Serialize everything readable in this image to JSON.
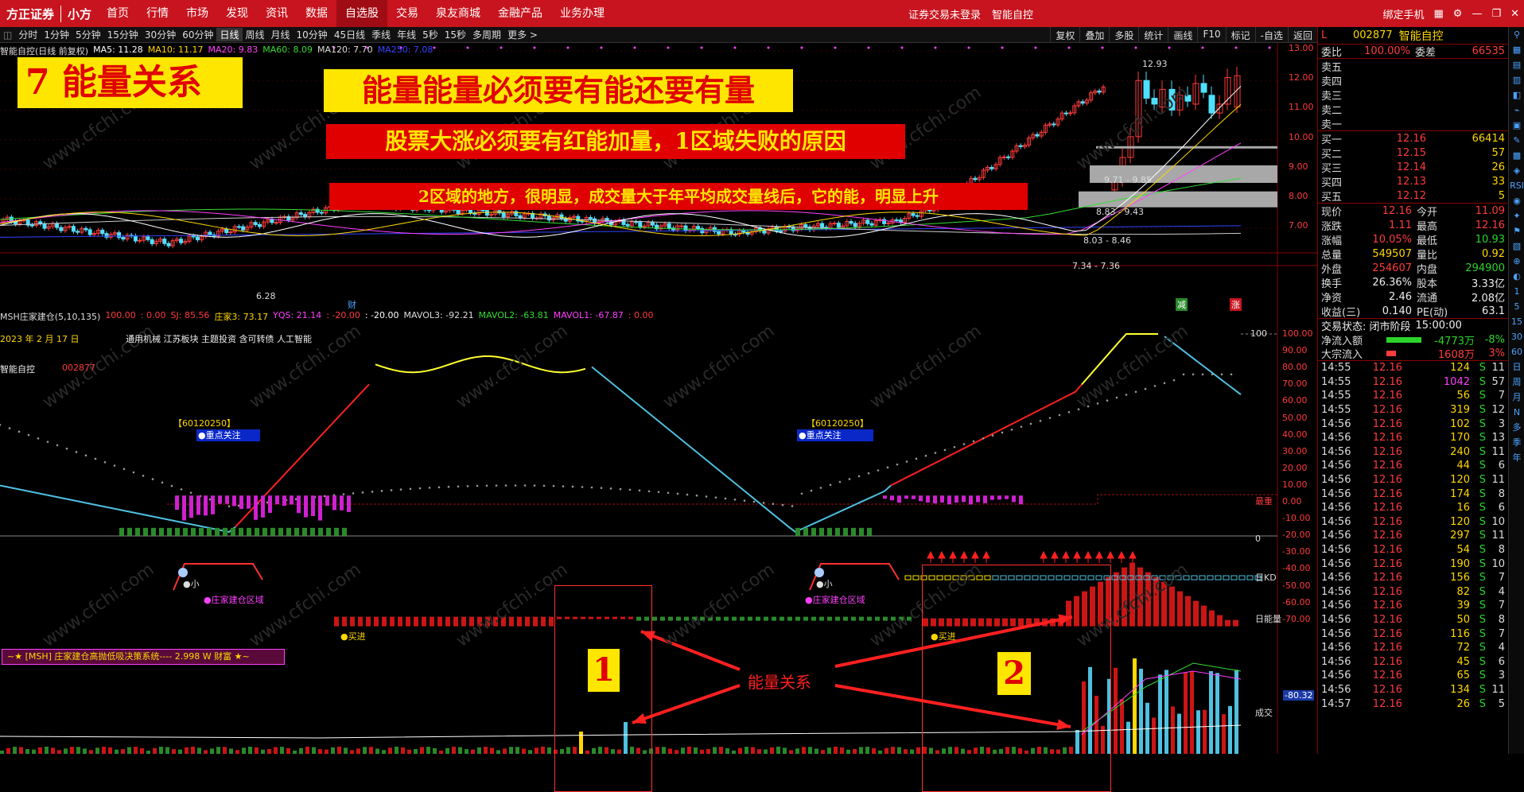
{
  "topbar": {
    "logo": "方正证券",
    "logo_sub": "小方",
    "nav": [
      "首页",
      "行情",
      "市场",
      "发现",
      "资讯",
      "数据",
      "自选股",
      "交易",
      "泉友商城",
      "金融产品",
      "业务办理"
    ],
    "nav_active": "自选股",
    "login_status": "证券交易未登录",
    "stock_name": "智能自控",
    "bind_phone": "绑定手机"
  },
  "periodbar": {
    "periods": [
      "分时",
      "1分钟",
      "5分钟",
      "15分钟",
      "30分钟",
      "60分钟",
      "日线",
      "周线",
      "月线",
      "10分钟",
      "45日线",
      "季线",
      "年线",
      "5秒",
      "15秒",
      "多周期",
      "更多 >"
    ],
    "active": "日线",
    "tools": [
      "复权",
      "叠加",
      "多股",
      "统计",
      "画线",
      "F10",
      "标记",
      "-自选",
      "返回"
    ]
  },
  "main_chart": {
    "title": "智能自控(日线 前复权)",
    "ma_labels": [
      {
        "text": "MA5: 11.28",
        "color": "#ffffff"
      },
      {
        "text": "MA10: 11.17",
        "color": "#ffd700"
      },
      {
        "text": "MA20: 9.83",
        "color": "#ff40ff"
      },
      {
        "text": "MA60: 8.09",
        "color": "#33dd33"
      },
      {
        "text": "MA120: 7.70",
        "color": "#dddddd"
      },
      {
        "text": "MA250: 7.08",
        "color": "#3344ff"
      }
    ],
    "price_ticks": [
      "13.00",
      "12.00",
      "11.00",
      "10.00",
      "9.00",
      "8.00",
      "7.00"
    ],
    "annotations": {
      "high": "12.93",
      "low": "6.28",
      "zone1": "9.71 - 9.85",
      "zone2": "8.83 - 9.43",
      "zone3": "8.03 - 8.46",
      "zone4": "7.34 - 7.36",
      "fin_mark": "财",
      "jian_mark": "减",
      "zhang_mark": "涨"
    }
  },
  "banners": {
    "title": "7  能量关系",
    "headline": "能量能量必须要有能还要有量",
    "line2": "股票大涨必须要有红能加量，1区域失败的原因",
    "line3": "2区域的地方，很明显，成交量大于年平均成交量线后，它的能，明显上升",
    "box1_label": "1",
    "box2_label": "2",
    "energy_label": "能量关系"
  },
  "indicator": {
    "header": "MSH庄家建仓(5,10,135)",
    "values": [
      {
        "text": "100.00",
        "color": "#ff3b3b"
      },
      {
        "text": ": 0.00",
        "color": "#ff3b3b"
      },
      {
        "text": "SJ: 85.56",
        "color": "#ff3b3b"
      },
      {
        "text": "庄家3: 73.17",
        "color": "#ffd700"
      },
      {
        "text": "YQS: 21.14",
        "color": "#ff40ff"
      },
      {
        "text": ": -20.00",
        "color": "#ff3b3b"
      },
      {
        "text": ": -20.00",
        "color": "#ffffff"
      },
      {
        "text": "MAVOL3: -92.21",
        "color": "#dddddd"
      },
      {
        "text": "MAVOL2: -63.81",
        "color": "#33dd33"
      },
      {
        "text": "MAVOL1: -67.87",
        "color": "#ff40ff"
      },
      {
        "text": ": 0.00",
        "color": "#ff3b3b"
      }
    ],
    "date": "2023 年 2 月 17 日",
    "concepts": "通用机械 江苏板块 主题投资 含可转债 人工智能",
    "stock": "智能自控",
    "code": "002877",
    "ticks": [
      "100.00",
      "90.00",
      "80.00",
      "70.00",
      "60.00",
      "50.00",
      "40.00",
      "30.00",
      "20.00",
      "10.00",
      "0.00",
      "-10.00",
      "-20.00",
      "-30.00",
      "-40.00",
      "-50.00",
      "-60.00",
      "-70.00"
    ],
    "line_100": "100",
    "line_0": "0",
    "tag_code": "【60120250】",
    "tag_focus": "●重点关注",
    "small_label": "●小",
    "build_zone": "●庄家建仓区域",
    "buy_label": "●买进",
    "system_label": "~★ [MSH] 庄家建仓高抛低吸决策系统----  2.998 W   财富 ★~",
    "right_tags": [
      "最重",
      "日KD",
      "日能量",
      "成交"
    ],
    "vol_value": "-80.32"
  },
  "quote": {
    "code": "002877",
    "name": "智能自控",
    "market_flag": "L",
    "wei_bi": "100.00%",
    "wei_cha": "66535",
    "sell": [
      {
        "l": "卖五",
        "p": "",
        "v": ""
      },
      {
        "l": "卖四",
        "p": "",
        "v": ""
      },
      {
        "l": "卖三",
        "p": "",
        "v": ""
      },
      {
        "l": "卖二",
        "p": "",
        "v": ""
      },
      {
        "l": "卖一",
        "p": "",
        "v": ""
      }
    ],
    "buy": [
      {
        "l": "买一",
        "p": "12.16",
        "v": "66414"
      },
      {
        "l": "买二",
        "p": "12.15",
        "v": "57"
      },
      {
        "l": "买三",
        "p": "12.14",
        "v": "26"
      },
      {
        "l": "买四",
        "p": "12.13",
        "v": "33"
      },
      {
        "l": "买五",
        "p": "12.12",
        "v": "5"
      }
    ],
    "stats": [
      {
        "l1": "现价",
        "v1": "12.16",
        "c1": "red",
        "l2": "今开",
        "v2": "11.09",
        "c2": "red"
      },
      {
        "l1": "涨跌",
        "v1": "1.11",
        "c1": "red",
        "l2": "最高",
        "v2": "12.16",
        "c2": "red"
      },
      {
        "l1": "涨幅",
        "v1": "10.05%",
        "c1": "red",
        "l2": "最低",
        "v2": "10.93",
        "c2": "grn"
      },
      {
        "l1": "总量",
        "v1": "549507",
        "c1": "yel",
        "l2": "量比",
        "v2": "0.92",
        "c2": "yel"
      },
      {
        "l1": "外盘",
        "v1": "254607",
        "c1": "red",
        "l2": "内盘",
        "v2": "294900",
        "c2": "grn"
      },
      {
        "l1": "换手",
        "v1": "26.36%",
        "c1": "wht",
        "l2": "股本",
        "v2": "3.33亿",
        "c2": "wht"
      },
      {
        "l1": "净资",
        "v1": "2.46",
        "c1": "wht",
        "l2": "流通",
        "v2": "2.08亿",
        "c2": "wht"
      },
      {
        "l1": "收益(三)",
        "v1": "0.140",
        "c1": "wht",
        "l2": "PE(动)",
        "v2": "63.1",
        "c2": "wht"
      }
    ],
    "trade_status_label": "交易状态: 闭市阶段",
    "trade_status_time": "15:00:00",
    "net_inflow_label": "净流入额",
    "net_inflow_value": "-4773万",
    "net_inflow_pct": "-8%",
    "block_inflow_label": "大宗流入",
    "block_inflow_value": "1608万",
    "block_inflow_pct": "3%",
    "ticks": [
      [
        "14:55",
        "12.16",
        "124",
        "S",
        "11"
      ],
      [
        "14:55",
        "12.16",
        "1042",
        "S",
        "57"
      ],
      [
        "14:55",
        "12.16",
        "56",
        "S",
        "7"
      ],
      [
        "14:55",
        "12.16",
        "319",
        "S",
        "12"
      ],
      [
        "14:56",
        "12.16",
        "102",
        "S",
        "3"
      ],
      [
        "14:56",
        "12.16",
        "170",
        "S",
        "13"
      ],
      [
        "14:56",
        "12.16",
        "240",
        "S",
        "11"
      ],
      [
        "14:56",
        "12.16",
        "44",
        "S",
        "6"
      ],
      [
        "14:56",
        "12.16",
        "120",
        "S",
        "11"
      ],
      [
        "14:56",
        "12.16",
        "174",
        "S",
        "8"
      ],
      [
        "14:56",
        "12.16",
        "16",
        "S",
        "6"
      ],
      [
        "14:56",
        "12.16",
        "120",
        "S",
        "10"
      ],
      [
        "14:56",
        "12.16",
        "297",
        "S",
        "11"
      ],
      [
        "14:56",
        "12.16",
        "54",
        "S",
        "8"
      ],
      [
        "14:56",
        "12.16",
        "190",
        "S",
        "10"
      ],
      [
        "14:56",
        "12.16",
        "156",
        "S",
        "7"
      ],
      [
        "14:56",
        "12.16",
        "82",
        "S",
        "4"
      ],
      [
        "14:56",
        "12.16",
        "39",
        "S",
        "7"
      ],
      [
        "14:56",
        "12.16",
        "50",
        "S",
        "8"
      ],
      [
        "14:56",
        "12.16",
        "116",
        "S",
        "7"
      ],
      [
        "14:56",
        "12.16",
        "72",
        "S",
        "4"
      ],
      [
        "14:56",
        "12.16",
        "45",
        "S",
        "6"
      ],
      [
        "14:56",
        "12.16",
        "65",
        "S",
        "3"
      ],
      [
        "14:56",
        "12.16",
        "134",
        "S",
        "11"
      ],
      [
        "14:57",
        "12.16",
        "26",
        "S",
        "5"
      ]
    ]
  },
  "sidebar_icons": [
    "⚲",
    "▦",
    "▤",
    "▥",
    "◧",
    "⌁",
    "▣",
    "✎",
    "▩",
    "◈",
    "RSI",
    "◉",
    "✦",
    "⚑",
    "▧",
    "⊕",
    "◐",
    "1",
    "5",
    "15",
    "30",
    "60",
    "日",
    "周",
    "月",
    "N",
    "多",
    "季",
    "年"
  ],
  "watermark": "www.cfchi.com"
}
